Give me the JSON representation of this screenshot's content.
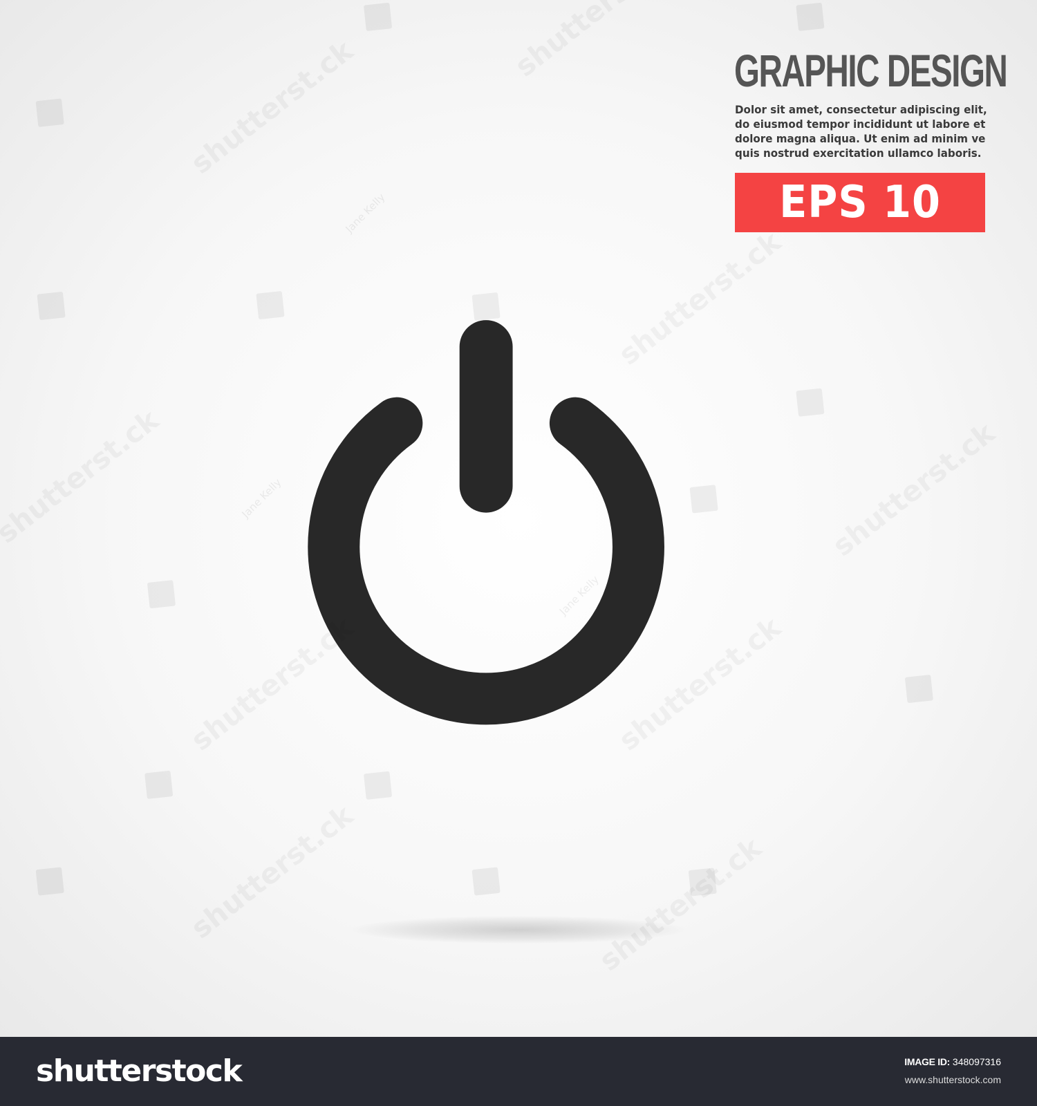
{
  "headline": "GRAPHIC DESIGN",
  "body_lines": [
    "Dolor sit amet, consectetur adipiscing elit,",
    "do eiusmod tempor incididunt ut labore et",
    "dolore magna aliqua. Ut enim ad minim ve",
    "quis nostrud exercitation ullamco laboris."
  ],
  "badge": {
    "text": "EPS 10",
    "color": "#f44343"
  },
  "icon": {
    "name": "power-icon",
    "color": "#282828"
  },
  "watermark": {
    "brand": "shutterstock",
    "author": "Jane Kelly",
    "brand_mark": "shutterst.ck"
  },
  "footer": {
    "logo_text": "shutterstock",
    "image_id_label": "IMAGE ID:",
    "image_id_value": "348097316",
    "site": "www.shutterstock.com",
    "background": "#282a33"
  }
}
